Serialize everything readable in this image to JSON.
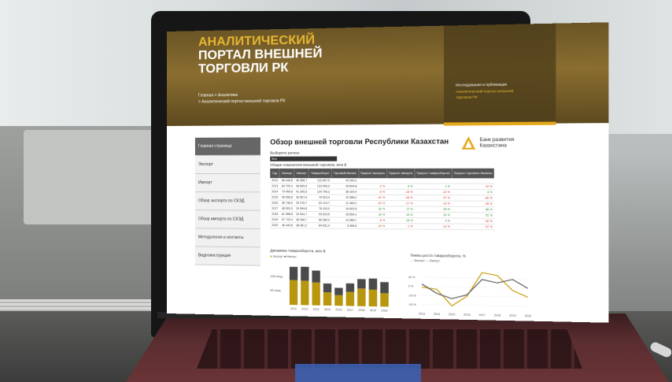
{
  "portal": {
    "title_line1": "АНАЛИТИЧЕСКИЙ",
    "title_line2": "ПОРТАЛ ВНЕШНЕЙ",
    "title_line3": "ТОРГОВЛИ РК",
    "breadcrumb": [
      "Главная > Аналитика",
      "> Аналитический портал внешней торговли РК"
    ],
    "side_links": [
      "Исследования и публикации",
      "Аналитический портал внешней",
      "торговли РК"
    ]
  },
  "sidebar": {
    "items": [
      {
        "label": "Главная страница",
        "active": true
      },
      {
        "label": "Экспорт",
        "active": false
      },
      {
        "label": "Импорт",
        "active": false
      },
      {
        "label": "Обзор экспорта по СКЭД",
        "active": false
      },
      {
        "label": "Обзор импорта по СКЭД",
        "active": false
      },
      {
        "label": "Методология и контакты",
        "active": false
      },
      {
        "label": "Видеоинструкция",
        "active": false
      }
    ]
  },
  "main": {
    "title": "Обзор внешней торговли Республики Казахстан",
    "logo_text": "Банк развития Казахстана",
    "region_label": "Выберите регион",
    "region_value": "Все",
    "table_caption": "Общие показатели внешней торговли, млн $",
    "headers": [
      "Год",
      "Экспорт",
      "Импорт",
      "Товарооборот",
      "Торговый баланс",
      "Прирост экспорта",
      "Прирост импорта",
      "Прирост товарооборота",
      "Прирост торгового баланса"
    ],
    "rows": [
      [
        "2012",
        "86 448,8",
        "46 358,7",
        "132 807,5",
        "40 090,2",
        "",
        "",
        "",
        ""
      ],
      [
        "2013",
        "84 700,4",
        "48 805,6",
        "133 506,0",
        "35 894,8",
        "-2 %",
        "5 %",
        "1 %",
        "-10 %"
      ],
      [
        "2014",
        "79 459,8",
        "41 295,5",
        "120 755,3",
        "38 164,4",
        "-6 %",
        "-15 %",
        "-10 %",
        "6 %"
      ],
      [
        "2015",
        "45 955,8",
        "30 567,6",
        "76 523,4",
        "15 388,2",
        "-42 %",
        "-26 %",
        "-37 %",
        "-60 %"
      ],
      [
        "2016",
        "36 736,9",
        "25 376,7",
        "62 113,7",
        "11 360,2",
        "-20 %",
        "-17 %",
        "-19 %",
        "-26 %"
      ],
      [
        "2017",
        "48 503,3",
        "29 599,8",
        "78 103,0",
        "18 903,5",
        "32 %",
        "17 %",
        "26 %",
        "66 %"
      ],
      [
        "2018",
        "61 088,8",
        "32 534,7",
        "93 623,5",
        "28 554,1",
        "26 %",
        "10 %",
        "20 %",
        "51 %"
      ],
      [
        "2019",
        "57 723,4",
        "38 356,7",
        "96 080,2",
        "19 366,7",
        "-6 %",
        "18 %",
        "3 %",
        "-32 %"
      ],
      [
        "2020",
        "46 449,8",
        "38 081,2",
        "84 531,0",
        "8 368,6",
        "-20 %",
        "-1 %",
        "-12 %",
        "-57 %"
      ]
    ],
    "bar_title": "Динамика товарооборота, млн $",
    "bar_legend": [
      "Экспорт",
      "Импорт"
    ],
    "line_title": "Темпы роста товарооборота, %",
    "line_legend": [
      "Экспорт",
      "Импорт"
    ]
  },
  "chart_data": [
    {
      "type": "bar",
      "title": "Динамика товарооборота, млн $",
      "categories": [
        "2012",
        "2013",
        "2014",
        "2015",
        "2016",
        "2017",
        "2018",
        "2019",
        "2020"
      ],
      "series": [
        {
          "name": "Экспорт",
          "values": [
            86448.8,
            84700.4,
            79459.8,
            45955.8,
            36736.9,
            48503.3,
            61088.8,
            57723.4,
            46449.8
          ]
        },
        {
          "name": "Импорт",
          "values": [
            46358.7,
            48805.6,
            41295.5,
            30567.6,
            25376.7,
            29599.8,
            32534.7,
            38356.7,
            38081.2
          ]
        }
      ],
      "stacked": true,
      "ylim": [
        0,
        140000
      ],
      "yticks": [
        "100 млд",
        "50 млд"
      ],
      "colors": [
        "#b8960d",
        "#4a4a4a"
      ]
    },
    {
      "type": "line",
      "title": "Темпы роста товарооборота, %",
      "categories": [
        "2013",
        "2014",
        "2015",
        "2016",
        "2017",
        "2018",
        "2019",
        "2020"
      ],
      "series": [
        {
          "name": "Экспорт",
          "values": [
            -2,
            -6,
            -42,
            -20,
            32,
            26,
            -6,
            -20
          ]
        },
        {
          "name": "Импорт",
          "values": [
            5,
            -15,
            -26,
            -17,
            17,
            10,
            18,
            -1
          ]
        }
      ],
      "ylim": [
        -50,
        40
      ],
      "yticks": [
        "20 %",
        "0 %",
        "-20 %",
        "-40 %"
      ],
      "colors": [
        "#c9a215",
        "#666666"
      ]
    }
  ]
}
